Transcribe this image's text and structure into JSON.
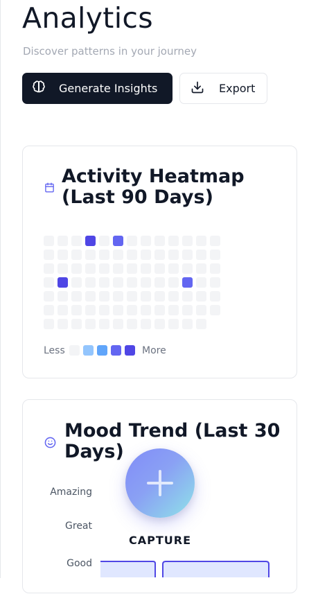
{
  "page": {
    "title": "Analytics",
    "subtitle": "Discover patterns in your journey"
  },
  "toolbar": {
    "generate_label": "Generate Insights",
    "generate_icon": "brain-icon",
    "export_label": "Export",
    "export_icon": "download-icon"
  },
  "heatmap": {
    "title": "Activity Heatmap (Last 90 Days)",
    "icon": "calendar-icon",
    "legend_less": "Less",
    "legend_more": "More",
    "levels": [
      "#f3f4f6",
      "#93c5fd",
      "#60a5fa",
      "#6366f1",
      "#4f46e5"
    ],
    "columns": 13,
    "rows": 7,
    "days": 90,
    "active": [
      {
        "day": 10,
        "level": 4
      },
      {
        "day": 21,
        "level": 4
      },
      {
        "day": 21,
        "level": 4
      },
      {
        "day": 35,
        "level": 3
      },
      {
        "day": 73,
        "level": 3
      }
    ]
  },
  "mood": {
    "title": "Mood Trend (Last 30 Days)",
    "icon": "smile-icon",
    "scale": [
      "Amazing",
      "Great",
      "Good"
    ],
    "accent": "#6366f1",
    "fill": "#e0e7ff"
  },
  "fab": {
    "label": "CAPTURE",
    "icon": "plus-icon"
  }
}
